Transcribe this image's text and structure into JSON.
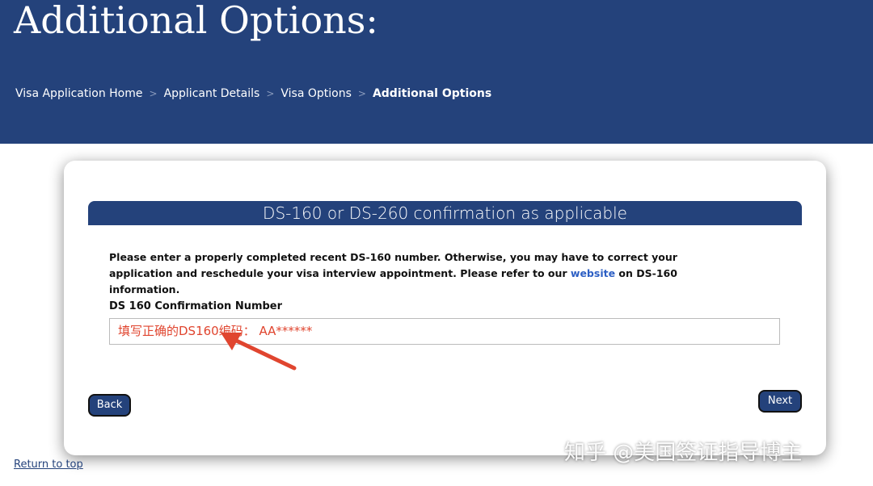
{
  "header": {
    "title": "Additional Options:",
    "breadcrumb": [
      "Visa Application Home",
      "Applicant Details",
      "Visa Options",
      "Additional Options"
    ],
    "separator": ">"
  },
  "section": {
    "title": "DS-160 or DS-260 confirmation as applicable",
    "intro_before": "Please enter a properly completed recent DS-160 number. Otherwise, you may have to correct your application and reschedule your visa interview appointment. Please refer to our ",
    "intro_link": "website",
    "intro_after": " on DS-160 information.",
    "field_label": "DS 160 Confirmation Number",
    "field_value": "填写正确的DS160编码： AA******"
  },
  "buttons": {
    "back": "Back",
    "next": "Next"
  },
  "footer": {
    "return_to_top": "Return to top"
  },
  "watermark": "知乎 @美国签证指导博主",
  "colors": {
    "brand": "#24427b",
    "annotation": "#e0452f"
  }
}
